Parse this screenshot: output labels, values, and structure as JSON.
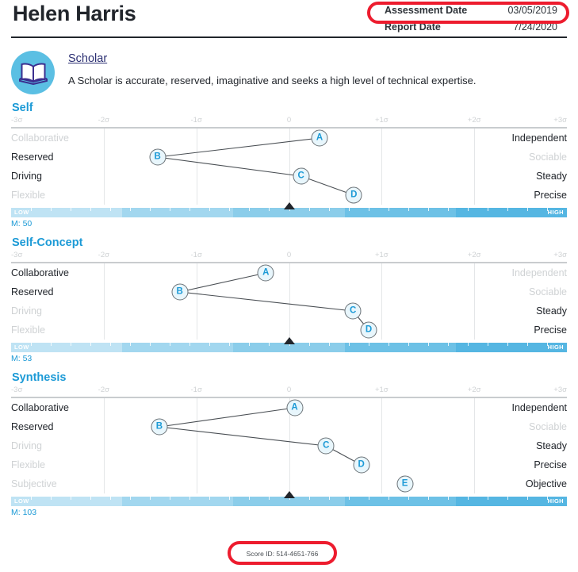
{
  "header": {
    "person_name": "Helen Harris",
    "dates": [
      {
        "label": "Assessment Date",
        "value": "03/05/2019"
      },
      {
        "label": "Report Date",
        "value": "7/24/2020"
      }
    ],
    "accent_red": "#ed1c2e"
  },
  "profile": {
    "icon": "open-book-icon",
    "title": "Scholar",
    "description": "A Scholar is accurate, reserved, imaginative and seeks a high level of technical expertise.",
    "badge_color": "#5bbfe3",
    "title_color": "#2b2f72"
  },
  "footer": {
    "score_id": "Score ID: 514-4651-766"
  },
  "axis": {
    "tick_labels": [
      "-3σ",
      "-2σ",
      "-1σ",
      "0",
      "+1σ",
      "+2σ",
      "+3σ"
    ],
    "range": [
      -3,
      3
    ],
    "grid": true
  },
  "band": {
    "low_label": "LOW",
    "high_label": "HIGH",
    "segment_colors": [
      "#bfe3f4",
      "#a2d7ef",
      "#8bcdea",
      "#6dc1e6",
      "#55b6e2"
    ]
  },
  "chart_data": [
    {
      "type": "line",
      "title": "Self",
      "xlabel": "",
      "ylabel": "",
      "xlim": [
        -3,
        3
      ],
      "grid": true,
      "m_label": "M: 50",
      "m_value": 50,
      "pointer_sigma": 0.0,
      "traits": [
        {
          "left": "Collaborative",
          "right": "Independent",
          "marker": "A",
          "sigma": 0.33,
          "left_emphasis": false,
          "right_emphasis": true
        },
        {
          "left": "Reserved",
          "right": "Sociable",
          "marker": "B",
          "sigma": -1.42,
          "left_emphasis": true,
          "right_emphasis": false
        },
        {
          "left": "Driving",
          "right": "Steady",
          "marker": "C",
          "sigma": 0.13,
          "left_emphasis": true,
          "right_emphasis": true
        },
        {
          "left": "Flexible",
          "right": "Precise",
          "marker": "D",
          "sigma": 0.7,
          "left_emphasis": false,
          "right_emphasis": true
        }
      ],
      "connections": [
        [
          "A",
          "B"
        ],
        [
          "B",
          "C"
        ],
        [
          "C",
          "D"
        ]
      ]
    },
    {
      "type": "line",
      "title": "Self-Concept",
      "xlabel": "",
      "ylabel": "",
      "xlim": [
        -3,
        3
      ],
      "grid": true,
      "m_label": "M: 53",
      "m_value": 53,
      "pointer_sigma": 0.0,
      "traits": [
        {
          "left": "Collaborative",
          "right": "Independent",
          "marker": "A",
          "sigma": -0.25,
          "left_emphasis": true,
          "right_emphasis": false
        },
        {
          "left": "Reserved",
          "right": "Sociable",
          "marker": "B",
          "sigma": -1.18,
          "left_emphasis": true,
          "right_emphasis": false
        },
        {
          "left": "Driving",
          "right": "Steady",
          "marker": "C",
          "sigma": 0.69,
          "left_emphasis": false,
          "right_emphasis": true
        },
        {
          "left": "Flexible",
          "right": "Precise",
          "marker": "D",
          "sigma": 0.86,
          "left_emphasis": false,
          "right_emphasis": true
        }
      ],
      "connections": [
        [
          "A",
          "B"
        ],
        [
          "B",
          "C"
        ],
        [
          "C",
          "D"
        ]
      ]
    },
    {
      "type": "line",
      "title": "Synthesis",
      "xlabel": "",
      "ylabel": "",
      "xlim": [
        -3,
        3
      ],
      "grid": true,
      "m_label": "M: 103",
      "m_value": 103,
      "pointer_sigma": 0.0,
      "traits": [
        {
          "left": "Collaborative",
          "right": "Independent",
          "marker": "A",
          "sigma": 0.06,
          "left_emphasis": true,
          "right_emphasis": true
        },
        {
          "left": "Reserved",
          "right": "Sociable",
          "marker": "B",
          "sigma": -1.4,
          "left_emphasis": true,
          "right_emphasis": false
        },
        {
          "left": "Driving",
          "right": "Steady",
          "marker": "C",
          "sigma": 0.4,
          "left_emphasis": false,
          "right_emphasis": true
        },
        {
          "left": "Flexible",
          "right": "Precise",
          "marker": "D",
          "sigma": 0.78,
          "left_emphasis": false,
          "right_emphasis": true
        },
        {
          "left": "Subjective",
          "right": "Objective",
          "marker": "E",
          "sigma": 1.25,
          "left_emphasis": false,
          "right_emphasis": true
        }
      ],
      "connections": [
        [
          "A",
          "B"
        ],
        [
          "B",
          "C"
        ],
        [
          "C",
          "D"
        ]
      ]
    }
  ]
}
